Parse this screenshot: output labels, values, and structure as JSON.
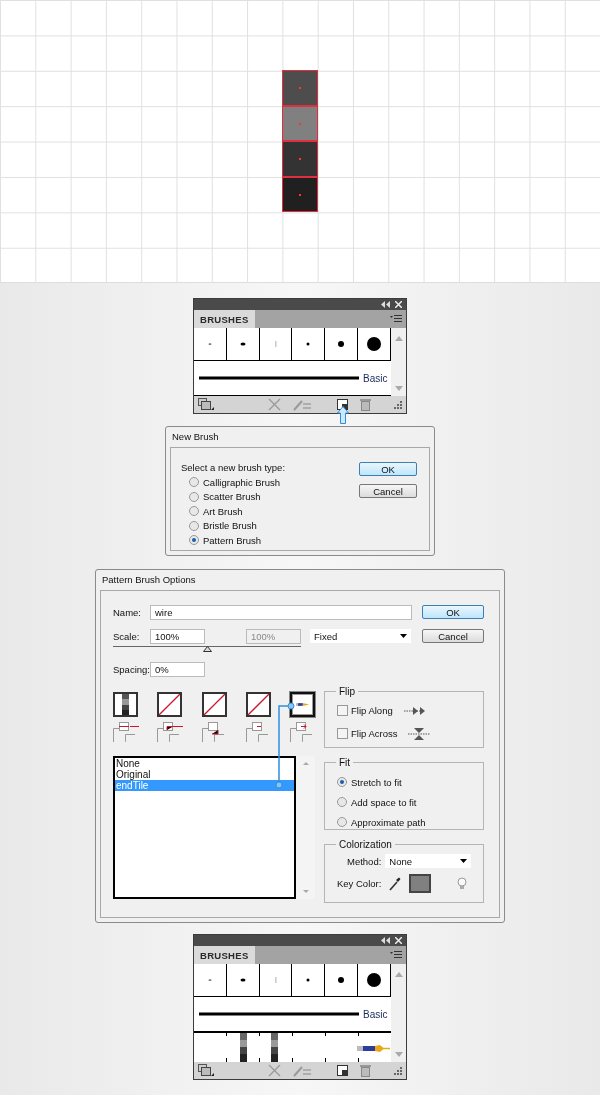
{
  "canvas": {
    "tiles": [
      {
        "color": "#4d4d4d"
      },
      {
        "color": "#808080"
      },
      {
        "color": "#333333"
      },
      {
        "color": "#202020"
      }
    ]
  },
  "brushes_panels": [
    {
      "tab": "BRUSHES",
      "basic_label": "Basic",
      "pattern_row": false,
      "pointer": true
    },
    {
      "tab": "BRUSHES",
      "basic_label": "Basic",
      "pattern_row": true,
      "pointer": false
    }
  ],
  "new_brush": {
    "title": "New Brush",
    "prompt": "Select a new brush type:",
    "options": [
      {
        "label": "Calligraphic Brush",
        "selected": false
      },
      {
        "label": "Scatter Brush",
        "selected": false
      },
      {
        "label": "Art Brush",
        "selected": false
      },
      {
        "label": "Bristle Brush",
        "selected": false
      },
      {
        "label": "Pattern Brush",
        "selected": true
      }
    ],
    "buttons": [
      "OK",
      "Cancel"
    ]
  },
  "pattern_options": {
    "title": "Pattern Brush Options",
    "name": {
      "label": "Name:",
      "value": "wire"
    },
    "scale": {
      "label": "Scale:",
      "value": "100%",
      "max_value": "100%",
      "method": "Fixed",
      "level": 0.5
    },
    "spacing": {
      "label": "Spacing:",
      "value": "0%"
    },
    "buttons": [
      "OK",
      "Cancel"
    ],
    "tiles": [
      {
        "kind": "stripes",
        "selected": false
      },
      {
        "kind": "empty",
        "selected": false
      },
      {
        "kind": "empty",
        "selected": false
      },
      {
        "kind": "empty",
        "selected": false
      },
      {
        "kind": "pencil",
        "selected": true
      }
    ],
    "tile_list": [
      {
        "label": "None",
        "selected": false
      },
      {
        "label": "Original",
        "selected": false
      },
      {
        "label": "endTile",
        "selected": true
      }
    ],
    "flip": {
      "title": "Flip",
      "options": [
        {
          "label": "Flip Along",
          "checked": false
        },
        {
          "label": "Flip Across",
          "checked": false
        }
      ]
    },
    "fit": {
      "title": "Fit",
      "options": [
        {
          "label": "Stretch to fit",
          "selected": true
        },
        {
          "label": "Add space to fit",
          "selected": false
        },
        {
          "label": "Approximate path",
          "selected": false
        }
      ]
    },
    "colorization": {
      "title": "Colorization",
      "method_label": "Method:",
      "method": "None",
      "key_color_label": "Key Color:"
    }
  }
}
